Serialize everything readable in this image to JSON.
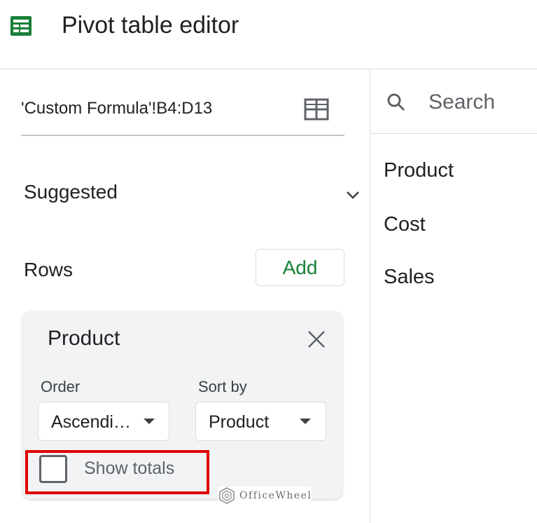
{
  "header": {
    "icon": "sheets-icon",
    "icon_color": "#188038",
    "title": "Pivot table editor"
  },
  "source": {
    "range": "'Custom Formula'!B4:D13",
    "icon": "grid-icon"
  },
  "suggested": {
    "label": "Suggested",
    "icon": "chevron-down-icon"
  },
  "rows": {
    "label": "Rows",
    "add_label": "Add",
    "add_color": "#188038"
  },
  "row_card": {
    "title": "Product",
    "close_icon": "close-icon",
    "order_label": "Order",
    "order_value": "Ascendi…",
    "sort_by_label": "Sort by",
    "sort_by_value": "Product",
    "show_totals_label": "Show totals",
    "show_totals_checked": false
  },
  "annotation": {
    "highlight_color": "#e00000"
  },
  "watermark": {
    "text": "OfficeWheel"
  },
  "field_list": {
    "search_placeholder": "Search",
    "fields": [
      "Product",
      "Cost",
      "Sales"
    ]
  }
}
